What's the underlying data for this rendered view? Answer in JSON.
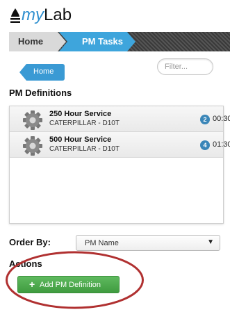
{
  "app": {
    "logo_text_my": "my",
    "logo_text_lab": "Lab"
  },
  "breadcrumb": {
    "home": "Home",
    "current": "PM Tasks"
  },
  "nav": {
    "home_button": "Home"
  },
  "filter": {
    "placeholder": "Filter..."
  },
  "section_title": "PM Definitions",
  "pm_definitions": [
    {
      "title": "250 Hour Service",
      "subtitle": "CATERPILLAR - D10T",
      "count": "2",
      "time": "00:30"
    },
    {
      "title": "500 Hour Service",
      "subtitle": "CATERPILLAR - D10T",
      "count": "4",
      "time": "01:30"
    }
  ],
  "order_by": {
    "label": "Order By:",
    "selected": "PM Name"
  },
  "actions": {
    "label": "Actions",
    "add_button": "Add PM Definition"
  },
  "colors": {
    "accent": "#3ea5dc",
    "badge": "#3a86b8",
    "add_button": "#4caf50",
    "annotation": "#b03030"
  }
}
